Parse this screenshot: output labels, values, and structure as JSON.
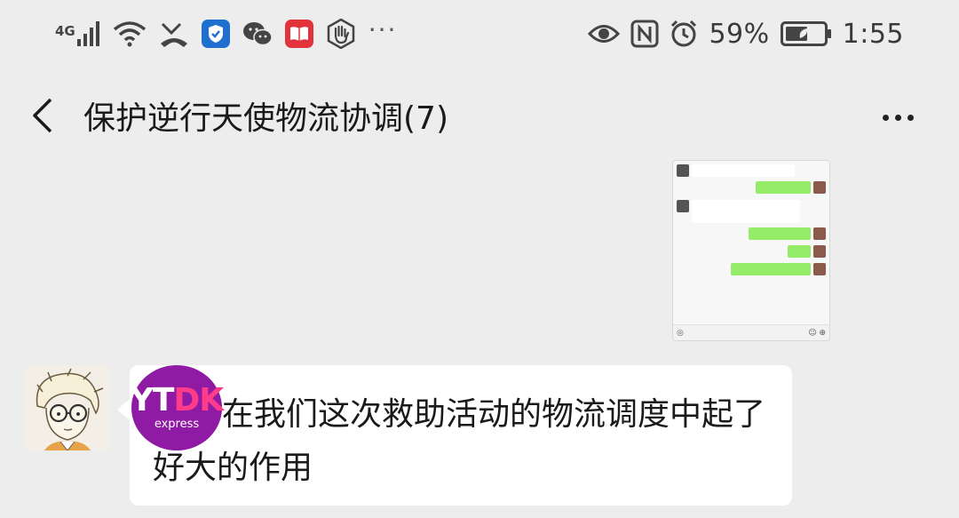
{
  "status_bar": {
    "network": "4G",
    "battery_percent": "59%",
    "time": "1:55",
    "overflow": "···",
    "icons_left": [
      "signal-icon",
      "wifi-icon",
      "missed-call-icon",
      "security-app-icon",
      "wechat-icon",
      "reader-app-icon",
      "hand-app-icon"
    ],
    "icons_right": [
      "eye-icon",
      "nfc-icon",
      "alarm-icon",
      "battery-icon"
    ]
  },
  "header": {
    "title": "保护逆行天使物流协调(7)"
  },
  "messages": [
    {
      "type": "image",
      "side": "right"
    },
    {
      "type": "text",
      "side": "left",
      "text": "在我们这次救助活动的物流调度中起了好大的作用"
    }
  ],
  "watermark": {
    "brand": "YTDK",
    "sub": "express"
  },
  "colors": {
    "background": "#ededed",
    "bubble_white": "#ffffff",
    "bubble_green": "#95ec69",
    "watermark": "#8f1aa3"
  }
}
